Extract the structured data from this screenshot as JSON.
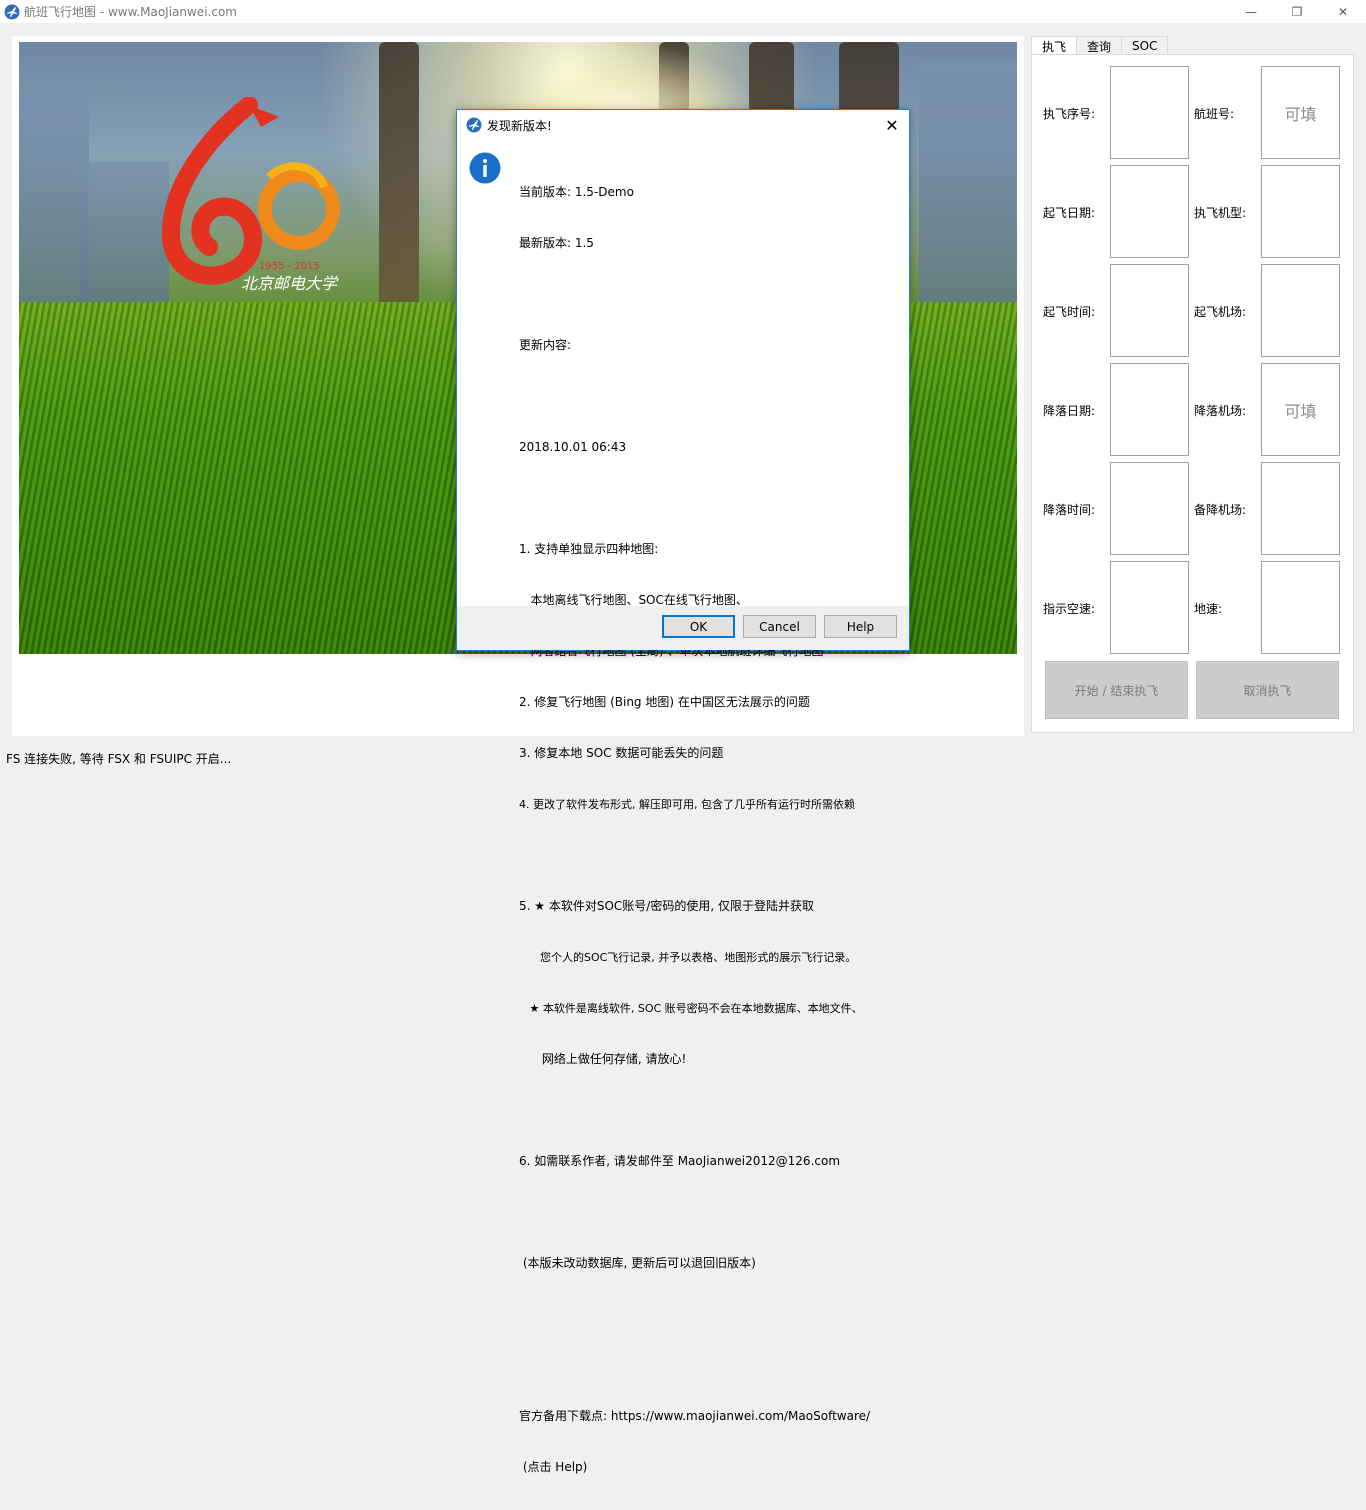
{
  "window": {
    "title": "航班飞行地图 - www.MaoJianwei.com",
    "minimize_glyph": "—",
    "maximize_glyph": "❐",
    "close_glyph": "✕"
  },
  "logo": {
    "years": "1955 - 2015",
    "text": "北京邮电大学"
  },
  "right_panel": {
    "tabs": [
      {
        "label": "执飞"
      },
      {
        "label": "查询"
      },
      {
        "label": "SOC"
      }
    ],
    "fields": [
      {
        "label": "执飞序号:",
        "value": ""
      },
      {
        "label": "航班号:",
        "value": "可填"
      },
      {
        "label": "起飞日期:",
        "value": ""
      },
      {
        "label": "执飞机型:",
        "value": ""
      },
      {
        "label": "起飞时间:",
        "value": ""
      },
      {
        "label": "起飞机场:",
        "value": ""
      },
      {
        "label": "降落日期:",
        "value": ""
      },
      {
        "label": "降落机场:",
        "value": "可填"
      },
      {
        "label": "降落时间:",
        "value": ""
      },
      {
        "label": "备降机场:",
        "value": ""
      },
      {
        "label": "指示空速:",
        "value": ""
      },
      {
        "label": "地速:",
        "value": ""
      }
    ],
    "start_button": "开始 / 结束执飞",
    "cancel_button": "取消执飞"
  },
  "status_bar": {
    "text": "FS 连接失败, 等待 FSX 和 FSUIPC 开启..."
  },
  "dialog": {
    "title": "发现新版本!",
    "close_glyph": "✕",
    "body_lines": [
      "当前版本: 1.5-Demo",
      "最新版本: 1.5",
      "",
      "更新内容:",
      "",
      "2018.10.01 06:43",
      "",
      "1. 支持单独显示四种地图:",
      "   本地离线飞行地图、SOC在线飞行地图、",
      "   两者结合飞行地图 (全局) 、单次本地航班详细飞行地图",
      "2. 修复飞行地图 (Bing 地图) 在中国区无法展示的问题",
      "3. 修复本地 SOC 数据可能丢失的问题",
      "4. 更改了软件发布形式, 解压即可用, 包含了几乎所有运行时所需依赖",
      "",
      "5. ★ 本软件对SOC账号/密码的使用, 仅限于登陆并获取",
      "      您个人的SOC飞行记录, 并予以表格、地图形式的展示飞行记录。",
      "   ★ 本软件是离线软件, SOC 账号密码不会在本地数据库、本地文件、",
      "      网络上做任何存储, 请放心!",
      "",
      "6. 如需联系作者, 请发邮件至 MaoJianwei2012@126.com",
      "",
      " (本版未改动数据库, 更新后可以退回旧版本)",
      "",
      "",
      "官方备用下载点: https://www.maojianwei.com/MaoSoftware/",
      " (点击 Help)"
    ],
    "buttons": {
      "ok": "OK",
      "cancel": "Cancel",
      "help": "Help"
    }
  },
  "colors": {
    "accent": "#0078d7",
    "dialog_border": "#1883d7",
    "disabled_button": "#cccccc"
  }
}
